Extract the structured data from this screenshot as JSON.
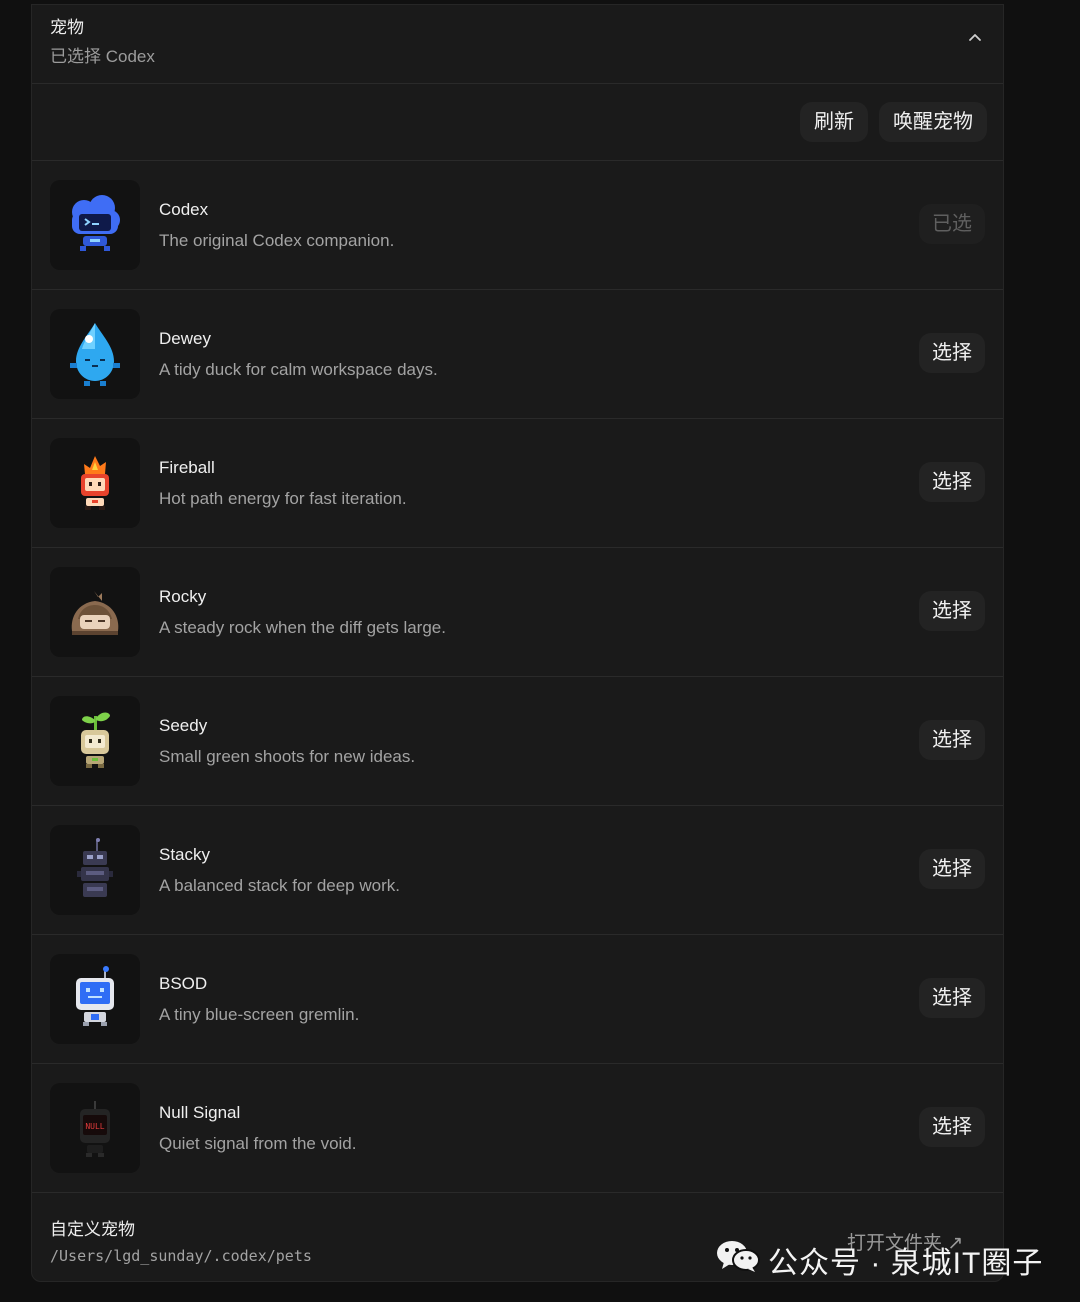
{
  "header": {
    "title": "宠物",
    "subtitle": "已选择 Codex"
  },
  "toolbar": {
    "refresh_label": "刷新",
    "wake_label": "唤醒宠物"
  },
  "pets": [
    {
      "name": "Codex",
      "description": "The original Codex companion.",
      "action": "已选",
      "selected": true
    },
    {
      "name": "Dewey",
      "description": "A tidy duck for calm workspace days.",
      "action": "选择",
      "selected": false
    },
    {
      "name": "Fireball",
      "description": "Hot path energy for fast iteration.",
      "action": "选择",
      "selected": false
    },
    {
      "name": "Rocky",
      "description": "A steady rock when the diff gets large.",
      "action": "选择",
      "selected": false
    },
    {
      "name": "Seedy",
      "description": "Small green shoots for new ideas.",
      "action": "选择",
      "selected": false
    },
    {
      "name": "Stacky",
      "description": "A balanced stack for deep work.",
      "action": "选择",
      "selected": false
    },
    {
      "name": "BSOD",
      "description": "A tiny blue-screen gremlin.",
      "action": "选择",
      "selected": false
    },
    {
      "name": "Null Signal",
      "description": "Quiet signal from the void.",
      "action": "选择",
      "selected": false,
      "badge": "NULL"
    }
  ],
  "footer": {
    "title": "自定义宠物",
    "path": "/Users/lgd_sunday/.codex/pets",
    "open_folder_label": "打开文件夹 ↗"
  },
  "watermark": {
    "text": "公众号 · 泉城IT圈子"
  }
}
